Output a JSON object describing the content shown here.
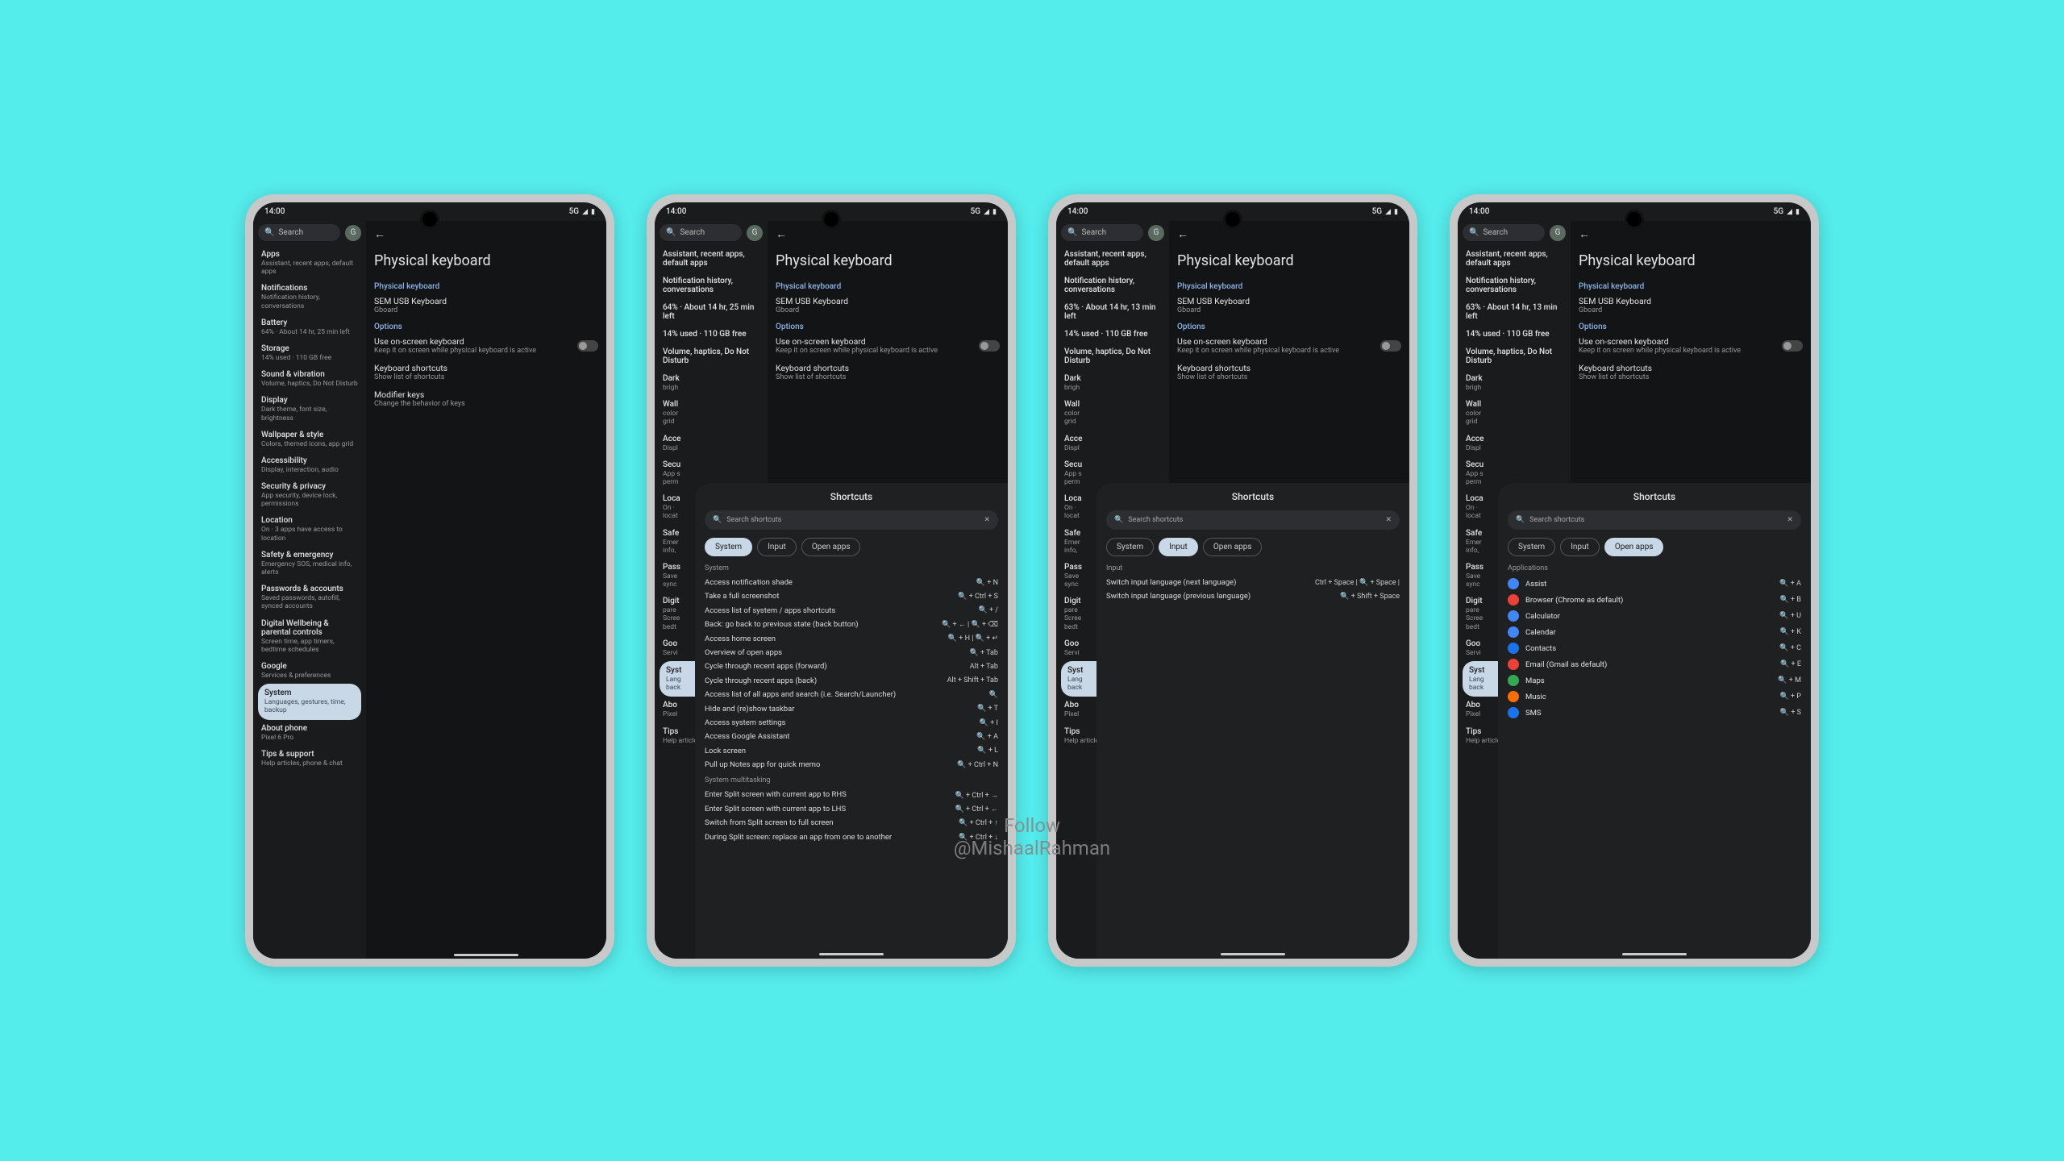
{
  "status": {
    "time": "14:00",
    "network": "5G"
  },
  "search_label": "Search",
  "avatar_letter": "G",
  "page_title": "Physical keyboard",
  "section_pk": "Physical keyboard",
  "keyboard_name": "SEM USB Keyboard",
  "keyboard_sub": "Gboard",
  "section_options": "Options",
  "opt_onscreen_title": "Use on-screen keyboard",
  "opt_onscreen_sub": "Keep it on screen while physical keyboard is active",
  "opt_shortcuts_title": "Keyboard shortcuts",
  "opt_shortcuts_sub": "Show list of shortcuts",
  "opt_modifier_title": "Modifier keys",
  "opt_modifier_sub": "Change the behavior of keys",
  "back_arrow": "←",
  "nav": [
    {
      "t": "Apps",
      "s": "Assistant, recent apps, default apps"
    },
    {
      "t": "Notifications",
      "s": "Notification history, conversations"
    },
    {
      "t": "Battery",
      "s_a": "64% · About 14 hr, 25 min left",
      "s_b": "63% · About 14 hr, 13 min left"
    },
    {
      "t": "Storage",
      "s": "14% used · 110 GB free"
    },
    {
      "t": "Sound & vibration",
      "s": "Volume, haptics, Do Not Disturb"
    },
    {
      "t": "Display",
      "s_full": "Dark theme, font size, brightness",
      "s_cut": "Dark\nbrigh"
    },
    {
      "t": "Wallpaper & style",
      "s_full": "Colors, themed icons, app grid",
      "s_cut": "Wall\ncolor\ngrid"
    },
    {
      "t": "Accessibility",
      "s_full": "Display, interaction, audio",
      "s_cut": "Acce\nDispl"
    },
    {
      "t": "Security & privacy",
      "s_full": "App security, device lock, permissions",
      "s_cut": "Secu\nApp s\nperm"
    },
    {
      "t": "Location",
      "s_full": "On · 3 apps have access to location",
      "s_cut": "Loca\nOn · \nlocat"
    },
    {
      "t": "Safety & emergency",
      "s_full": "Emergency SOS, medical info, alerts",
      "s_cut": "Safe\nEmer\ninfo,"
    },
    {
      "t": "Passwords & accounts",
      "s_full": "Saved passwords, autofill, synced accounts",
      "s_cut": "Pass\nSave\nsync"
    },
    {
      "t": "Digital Wellbeing & parental controls",
      "s_full": "Screen time, app timers, bedtime schedules",
      "s_cut": "Digit\npare\nScree\nbedt"
    },
    {
      "t": "Google",
      "s_full": "Services & preferences",
      "s_cut": "Goo\nServi"
    },
    {
      "t": "System",
      "s_full": "Languages, gestures, time, backup",
      "s_cut": "Syst\nLang\nback"
    },
    {
      "t": "About phone",
      "s_full": "Pixel 6 Pro",
      "s_cut": "Abo\nPixel"
    },
    {
      "t": "Tips & support",
      "s_full": "Help articles, phone & chat",
      "s_cut": "Tips\nHelp articles, phone & chat"
    }
  ],
  "overlay": {
    "title": "Shortcuts",
    "search_placeholder": "Search shortcuts",
    "tabs": [
      "System",
      "Input",
      "Open apps"
    ],
    "system_group1": "System",
    "system_rows": [
      {
        "l": "Access notification shade",
        "k": "🔍 + N"
      },
      {
        "l": "Take a full screenshot",
        "k": "🔍 + Ctrl + S"
      },
      {
        "l": "Access list of system / apps shortcuts",
        "k": "🔍 + /"
      },
      {
        "l": "Back: go back to previous state (back button)",
        "k": "🔍 + ← | 🔍 + ⌫"
      },
      {
        "l": "Access home screen",
        "k": "🔍 + H | 🔍 + ↵"
      },
      {
        "l": "Overview of open apps",
        "k": "🔍 + Tab"
      },
      {
        "l": "Cycle through recent apps (forward)",
        "k": "Alt + Tab"
      },
      {
        "l": "Cycle through recent apps (back)",
        "k": "Alt + Shift + Tab"
      },
      {
        "l": "Access list of all apps and search (i.e. Search/Launcher)",
        "k": "🔍"
      },
      {
        "l": "Hide and (re)show taskbar",
        "k": "🔍 + T"
      },
      {
        "l": "Access system settings",
        "k": "🔍 + I"
      },
      {
        "l": "Access Google Assistant",
        "k": "🔍 + A"
      },
      {
        "l": "Lock screen",
        "k": "🔍 + L"
      },
      {
        "l": "Pull up Notes app for quick memo",
        "k": "🔍 + Ctrl + N"
      }
    ],
    "system_group2": "System multitasking",
    "multitask_rows": [
      {
        "l": "Enter Split screen with current app to RHS",
        "k": "🔍 + Ctrl + →"
      },
      {
        "l": "Enter Split screen with current app to LHS",
        "k": "🔍 + Ctrl + ←"
      },
      {
        "l": "Switch from Split screen to full screen",
        "k": "🔍 + Ctrl + ↑"
      },
      {
        "l": "During Split screen: replace an app from one to another",
        "k": "🔍 + Ctrl + ↓"
      }
    ],
    "input_group": "Input",
    "input_rows": [
      {
        "l": "Switch input language (next language)",
        "k": "Ctrl + Space | 🔍 + Space |"
      },
      {
        "l": "Switch input language (previous language)",
        "k": "🔍 + Shift + Space"
      }
    ],
    "apps_group": "Applications",
    "apps_rows": [
      {
        "l": "Assist",
        "k": "🔍 + A",
        "c": "#4285f4"
      },
      {
        "l": "Browser (Chrome as default)",
        "k": "🔍 + B",
        "c": "#ea4335"
      },
      {
        "l": "Calculator",
        "k": "🔍 + U",
        "c": "#4285f4"
      },
      {
        "l": "Calendar",
        "k": "🔍 + K",
        "c": "#4285f4"
      },
      {
        "l": "Contacts",
        "k": "🔍 + C",
        "c": "#1a73e8"
      },
      {
        "l": "Email (Gmail as default)",
        "k": "🔍 + E",
        "c": "#ea4335"
      },
      {
        "l": "Maps",
        "k": "🔍 + M",
        "c": "#34a853"
      },
      {
        "l": "Music",
        "k": "🔍 + P",
        "c": "#ff6d00"
      },
      {
        "l": "SMS",
        "k": "🔍 + S",
        "c": "#1a73e8"
      }
    ]
  },
  "watermark_l1": "Follow",
  "watermark_l2": "@MishaalRahman"
}
